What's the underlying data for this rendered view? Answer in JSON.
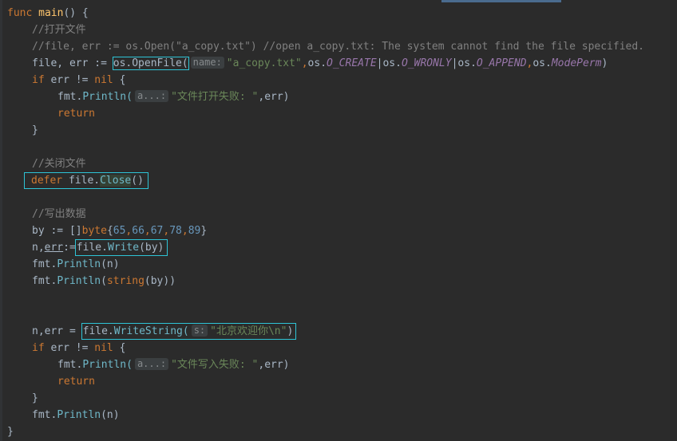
{
  "editor": {
    "lines": {
      "l1": {
        "kw": "func",
        "name": "main",
        "rest": "() {"
      },
      "l2": {
        "comment": "//打开文件"
      },
      "l3": {
        "comment": "//file, err := os.Open(\"a_copy.txt\") //open a_copy.txt: The system cannot find the file specified."
      },
      "l4": {
        "p1": "file, err := ",
        "call": "os.OpenFile(",
        "hint": "name:",
        "arg1": "\"a_copy.txt\"",
        "c1": ",",
        "os1": "os.",
        "k1": "O_CREATE",
        "bar1": "|",
        "os2": "os.",
        "k2": "O_WRONLY",
        "bar2": "|",
        "os3": "os.",
        "k3": "O_APPEND",
        "c2": ",",
        "os4": "os.",
        "k4": "ModePerm",
        "end": ")"
      },
      "l5": {
        "kw": "if",
        "rest": " err != ",
        "nil": "nil",
        "brace": " {"
      },
      "l6": {
        "pkg": "fmt.",
        "fn": "Println(",
        "hint": "a...:",
        "str": "\"文件打开失败: \"",
        "rest": ",err)"
      },
      "l7": {
        "kw": "return"
      },
      "l8": {
        "brace": "}"
      },
      "l10": {
        "comment": "//关闭文件"
      },
      "l11": {
        "kw": "defer",
        "obj": " file.",
        "fn": "Close",
        "end": "()"
      },
      "l13": {
        "comment": "//写出数据"
      },
      "l14": {
        "p1": "by := []",
        "typ": "byte",
        "b1": "{",
        "n1": "65",
        "c1": ",",
        "n2": "66",
        "c2": ",",
        "n3": "67",
        "c3": ",",
        "n4": "78",
        "c4": ",",
        "n5": "89",
        "b2": "}"
      },
      "l15": {
        "p1": "n,",
        "err": "err",
        "p2": ":=",
        "obj": "file.",
        "fn": "Write",
        "end": "(by)"
      },
      "l16": {
        "pkg": "fmt.",
        "fn": "Println",
        "end": "(n)"
      },
      "l17": {
        "pkg": "fmt.",
        "fn": "Println",
        "p1": "(",
        "typ": "string",
        "end": "(by))"
      },
      "l20": {
        "p1": "n,err = ",
        "obj": "file.",
        "fn": "WriteString(",
        "hint": "s:",
        "str": "\"北京欢迎你\\n\"",
        "end": ")"
      },
      "l21": {
        "kw": "if",
        "rest": " err != ",
        "nil": "nil",
        "brace": " {"
      },
      "l22": {
        "pkg": "fmt.",
        "fn": "Println(",
        "hint": "a...:",
        "str": "\"文件写入失败: \"",
        "rest": ",err)"
      },
      "l23": {
        "kw": "return"
      },
      "l24": {
        "brace": "}"
      },
      "l25": {
        "pkg": "fmt.",
        "fn": "Println",
        "end": "(n)"
      },
      "l26": {
        "brace": "}"
      }
    }
  },
  "colors": {
    "background": "#2b2b2b",
    "keyword": "#cc7832",
    "string": "#6a8759",
    "comment": "#808080",
    "number": "#6897bb",
    "highlight_box": "#2ec4d6"
  }
}
